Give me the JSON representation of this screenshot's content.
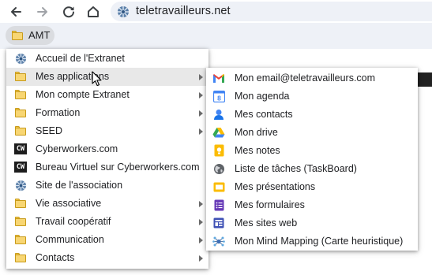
{
  "browser": {
    "url": "teletravailleurs.net",
    "back_icon": "arrow-left-icon",
    "forward_icon": "arrow-right-icon",
    "reload_icon": "reload-icon",
    "home_icon": "home-icon"
  },
  "bookmarks": {
    "folder_label": "AMT"
  },
  "main_menu": {
    "items": [
      {
        "label": "Accueil de l'Extranet",
        "icon": "site-logo-icon"
      },
      {
        "label": "Mes applications",
        "icon": "folder-icon"
      },
      {
        "label": "Mon compte Extranet",
        "icon": "folder-icon"
      },
      {
        "label": "Formation",
        "icon": "folder-icon"
      },
      {
        "label": "SEED",
        "icon": "folder-icon"
      },
      {
        "label": "Cyberworkers.com",
        "icon": "cw-icon"
      },
      {
        "label": "Bureau Virtuel sur Cyberworkers.com",
        "icon": "cw-icon"
      },
      {
        "label": "Site de l'association",
        "icon": "site-logo-icon"
      },
      {
        "label": "Vie associative",
        "icon": "folder-icon"
      },
      {
        "label": "Travail coopératif",
        "icon": "folder-icon"
      },
      {
        "label": "Communication",
        "icon": "folder-icon"
      },
      {
        "label": "Contacts",
        "icon": "folder-icon"
      }
    ],
    "cw_text": "CW"
  },
  "sub_menu": {
    "items": [
      {
        "label": "Mon email@teletravailleurs.com",
        "icon": "gmail-icon"
      },
      {
        "label": "Mon agenda",
        "icon": "calendar-icon"
      },
      {
        "label": "Mes contacts",
        "icon": "contacts-icon"
      },
      {
        "label": "Mon drive",
        "icon": "drive-icon"
      },
      {
        "label": "Mes notes",
        "icon": "keep-icon"
      },
      {
        "label": "Liste de tâches (TaskBoard)",
        "icon": "globe-icon"
      },
      {
        "label": "Mes présentations",
        "icon": "slides-icon"
      },
      {
        "label": "Mes formulaires",
        "icon": "forms-icon"
      },
      {
        "label": "Mes sites web",
        "icon": "sites-icon"
      },
      {
        "label": "Mon Mind Mapping (Carte heuristique)",
        "icon": "mindmap-icon"
      }
    ],
    "calendar_number": "8"
  },
  "colors": {
    "toolbar_bg": "#eef1f7",
    "hover_bg": "#e8e8e8",
    "folder_yellow": "#f8d673"
  }
}
